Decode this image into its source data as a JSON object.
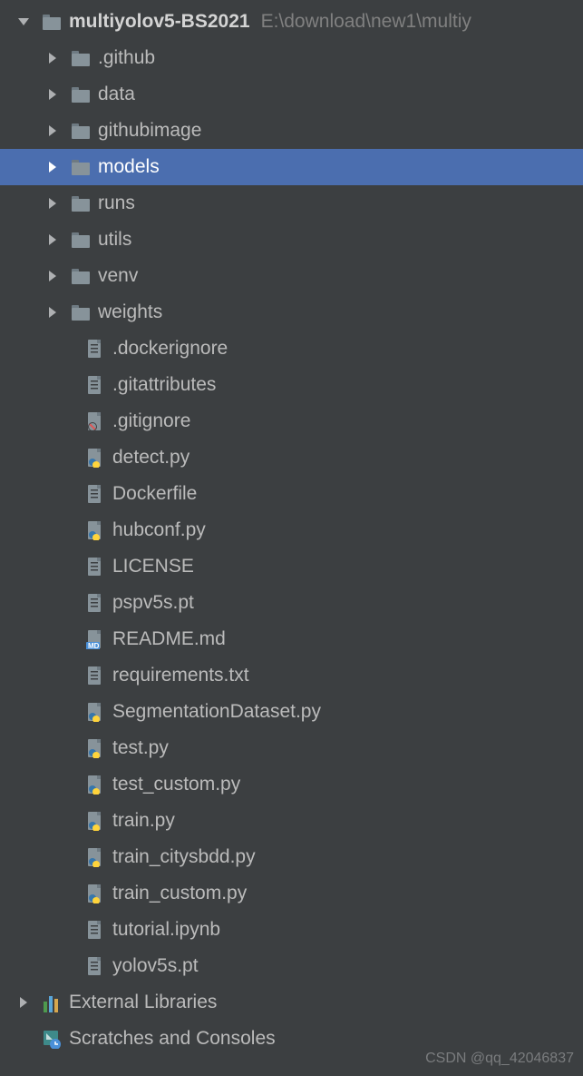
{
  "root": {
    "name": "multiyolov5-BS2021",
    "path": "E:\\download\\new1\\multiy"
  },
  "folders": [
    {
      "name": ".github",
      "type": "folder"
    },
    {
      "name": "data",
      "type": "folder"
    },
    {
      "name": "githubimage",
      "type": "folder"
    },
    {
      "name": "models",
      "type": "folder-blue",
      "selected": true
    },
    {
      "name": "runs",
      "type": "folder"
    },
    {
      "name": "utils",
      "type": "folder-blue"
    },
    {
      "name": "venv",
      "type": "folder"
    },
    {
      "name": "weights",
      "type": "folder"
    }
  ],
  "files": [
    {
      "name": ".dockerignore",
      "type": "file"
    },
    {
      "name": ".gitattributes",
      "type": "file"
    },
    {
      "name": ".gitignore",
      "type": "gitignore"
    },
    {
      "name": "detect.py",
      "type": "python"
    },
    {
      "name": "Dockerfile",
      "type": "file"
    },
    {
      "name": "hubconf.py",
      "type": "python"
    },
    {
      "name": "LICENSE",
      "type": "file"
    },
    {
      "name": "pspv5s.pt",
      "type": "file"
    },
    {
      "name": "README.md",
      "type": "markdown"
    },
    {
      "name": "requirements.txt",
      "type": "file"
    },
    {
      "name": "SegmentationDataset.py",
      "type": "python"
    },
    {
      "name": "test.py",
      "type": "python"
    },
    {
      "name": "test_custom.py",
      "type": "python"
    },
    {
      "name": "train.py",
      "type": "python"
    },
    {
      "name": "train_citysbdd.py",
      "type": "python"
    },
    {
      "name": "train_custom.py",
      "type": "python"
    },
    {
      "name": "tutorial.ipynb",
      "type": "file"
    },
    {
      "name": "yolov5s.pt",
      "type": "file"
    }
  ],
  "bottom": {
    "external_libraries": "External Libraries",
    "scratches": "Scratches and Consoles"
  },
  "watermark": "CSDN @qq_42046837"
}
